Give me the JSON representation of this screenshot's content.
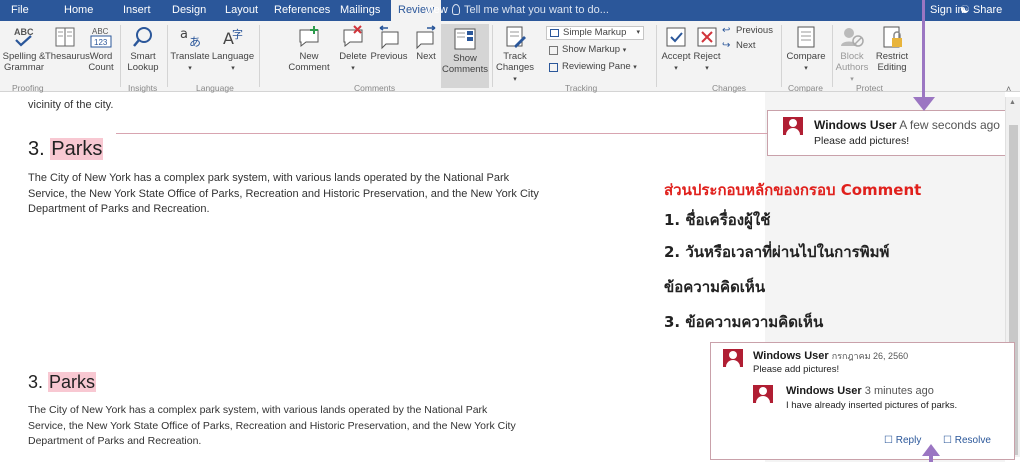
{
  "ribbon": {
    "tabs": [
      "File",
      "Home",
      "Insert",
      "Design",
      "Layout",
      "References",
      "Mailings",
      "Review",
      "View"
    ],
    "active_tab": "Review",
    "tell_me": "Tell me what you want to do...",
    "sign_in": "Sign in",
    "share": "Share",
    "buttons": {
      "spelling": "Spelling & Grammar",
      "thesaurus": "Thesaurus",
      "word_count_1": "Word",
      "word_count_2": "Count",
      "smart_lookup_1": "Smart",
      "smart_lookup_2": "Lookup",
      "translate": "Translate",
      "language": "Language",
      "new_comment_1": "New",
      "new_comment_2": "Comment",
      "delete": "Delete",
      "previous": "Previous",
      "next": "Next",
      "show_comments_1": "Show",
      "show_comments_2": "Comments",
      "track_changes_1": "Track",
      "track_changes_2": "Changes",
      "simple_markup": "Simple Markup",
      "show_markup": "Show Markup",
      "reviewing_pane": "Reviewing Pane",
      "accept": "Accept",
      "reject": "Reject",
      "changes_previous": "Previous",
      "changes_next": "Next",
      "compare": "Compare",
      "block_authors_1": "Block",
      "block_authors_2": "Authors",
      "restrict_editing_1": "Restrict",
      "restrict_editing_2": "Editing"
    },
    "groups": [
      "Proofing",
      "Insights",
      "Language",
      "Comments",
      "Tracking",
      "Changes",
      "Compare",
      "Protect"
    ]
  },
  "document": {
    "top_fragment": "vicinity of the city.",
    "section_number": "3.",
    "section_title": "Parks",
    "paragraph_lines": [
      "The City of New York has a complex park system, with various lands operated by the National Park",
      "Service, the New York State Office of Parks, Recreation and Historic Preservation, and the New York City",
      "Department of Parks and Recreation."
    ]
  },
  "top_comment": {
    "user": "Windows User",
    "time": "A few seconds ago",
    "text": "Please add pictures!"
  },
  "annotation": {
    "title": "ส่วนประกอบหลักของกรอบ Comment",
    "items": [
      "1. ชื่อเครื่องผู้ใช้",
      "2. วันหรือเวลาที่ผ่านไปในการพิมพ์",
      "ข้อความคิดเห็น",
      "3. ข้อความความคิดเห็น"
    ]
  },
  "bottom_document": {
    "section_number": "3.",
    "section_title": "Parks",
    "paragraph_lines": [
      "The City of New York has a complex park system, with various lands operated by the National Park",
      "Service, the New York State Office of Parks, Recreation and Historic Preservation, and the New York City",
      "Department of Parks and Recreation."
    ]
  },
  "bottom_comment": {
    "user": "Windows User",
    "date": "กรกฎาคม 26, 2560",
    "text": "Please add pictures!",
    "reply": {
      "user": "Windows User",
      "time": "3 minutes ago",
      "text": "I have already inserted pictures of parks."
    },
    "reply_button": "Reply",
    "resolve_button": "Resolve"
  },
  "colors": {
    "ribbon_blue": "#2b579a",
    "highlight_pink": "#f8c8d2",
    "annotation_red": "#e0201c",
    "avatar_red": "#b01e33",
    "arrow_purple": "#9b76c2"
  }
}
